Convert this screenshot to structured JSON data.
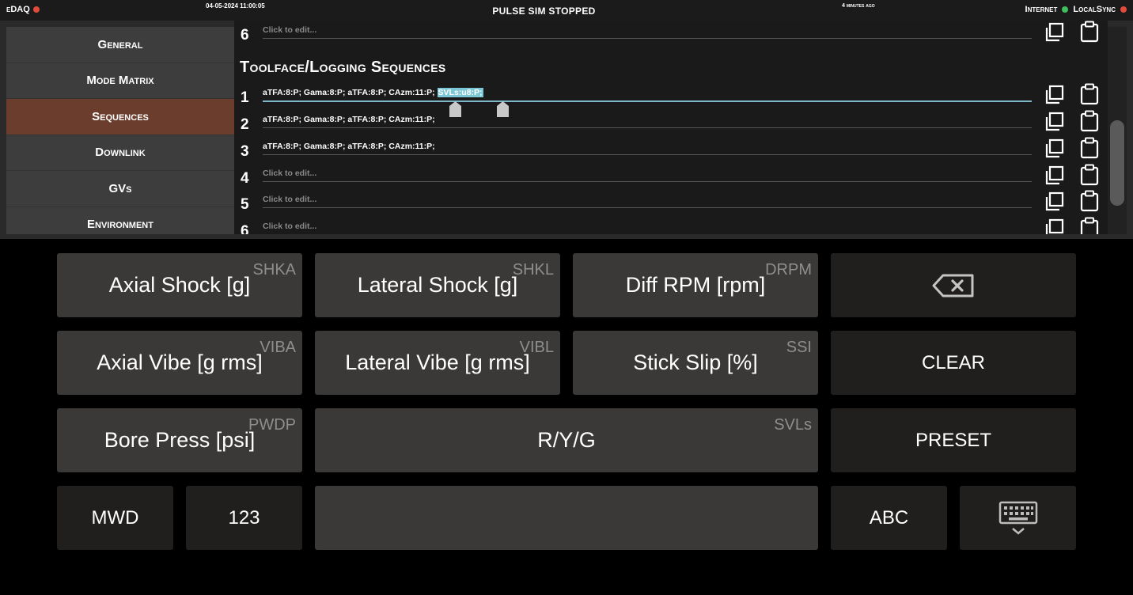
{
  "topbar": {
    "app": "eDAQ",
    "app_status_color": "#e24b3b",
    "date": "04-05-2024 11:00:05",
    "status": "PULSE SIM STOPPED",
    "ago": "4 minutes ago",
    "internet": "Internet",
    "internet_color": "#3fc05b",
    "localsync": "LocalSync",
    "localsync_color": "#e24b3b"
  },
  "sidebar": {
    "items": [
      {
        "label": "General"
      },
      {
        "label": "Mode Matrix"
      },
      {
        "label": "Sequences",
        "active": true
      },
      {
        "label": "Downlink"
      },
      {
        "label": "GVs"
      },
      {
        "label": "Environment"
      }
    ]
  },
  "prev_section": {
    "row6": {
      "num": "6",
      "text": "Click to edit..."
    }
  },
  "section": {
    "title": "Toolface/Logging Sequences",
    "rows": [
      {
        "num": "1",
        "text": "aTFA:8:P; Gama:8:P; aTFA:8:P; CAzm:11:P; ",
        "selected": "SVLs:u8:P;"
      },
      {
        "num": "2",
        "text": "aTFA:8:P; Gama:8:P; aTFA:8:P; CAzm:11:P;"
      },
      {
        "num": "3",
        "text": "aTFA:8:P; Gama:8:P; aTFA:8:P; CAzm:11:P;"
      },
      {
        "num": "4",
        "text": "Click to edit..."
      },
      {
        "num": "5",
        "text": "Click to edit..."
      },
      {
        "num": "6",
        "text": "Click to edit..."
      }
    ]
  },
  "keys": {
    "axial_shock": {
      "label": "Axial Shock [g]",
      "code": "SHKA"
    },
    "lateral_shock": {
      "label": "Lateral Shock [g]",
      "code": "SHKL"
    },
    "diff_rpm": {
      "label": "Diff RPM [rpm]",
      "code": "DRPM"
    },
    "axial_vibe": {
      "label": "Axial Vibe [g rms]",
      "code": "VIBA"
    },
    "lateral_vibe": {
      "label": "Lateral Vibe [g rms]",
      "code": "VIBL"
    },
    "stick_slip": {
      "label": "Stick Slip [%]",
      "code": "SSI"
    },
    "clear": {
      "label": "CLEAR"
    },
    "bore_press": {
      "label": "Bore Press [psi]",
      "code": "PWDP"
    },
    "ryg": {
      "label": "R/Y/G",
      "code": "SVLs"
    },
    "preset": {
      "label": "PRESET"
    },
    "mwd": {
      "label": "MWD"
    },
    "num": {
      "label": "123"
    },
    "abc": {
      "label": "ABC"
    }
  }
}
